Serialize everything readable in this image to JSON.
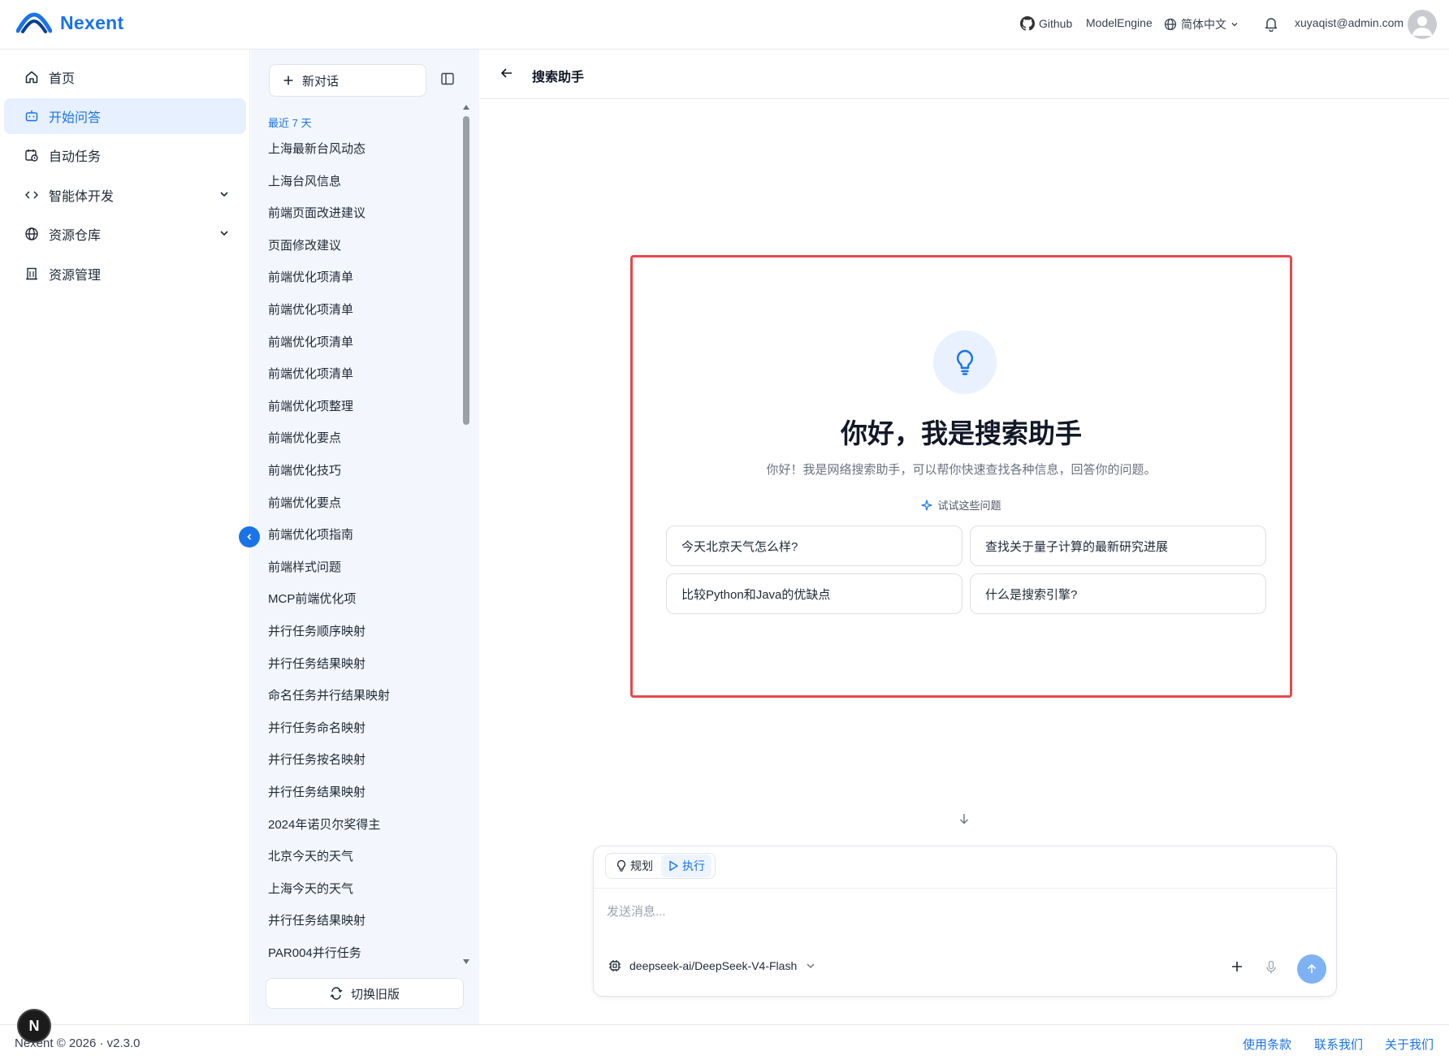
{
  "header": {
    "brand": "Nexent",
    "github_label": "Github",
    "modelengine_label": "ModelEngine",
    "language_label": "简体中文",
    "user_email": "xuyaqist@admin.com"
  },
  "nav": {
    "items": [
      {
        "label": "首页",
        "icon": "home-icon"
      },
      {
        "label": "开始问答",
        "icon": "robot-icon",
        "active": true
      },
      {
        "label": "自动任务",
        "icon": "calendar-clock-icon"
      },
      {
        "label": "智能体开发",
        "icon": "code-icon",
        "expandable": true
      },
      {
        "label": "资源仓库",
        "icon": "globe-icon",
        "expandable": true
      },
      {
        "label": "资源管理",
        "icon": "building-icon"
      }
    ]
  },
  "conversations": {
    "new_chat_label": "新对话",
    "recent_label": "最近 7 天",
    "items": [
      "上海最新台风动态",
      "上海台风信息",
      "前端页面改进建议",
      "页面修改建议",
      "前端优化项清单",
      "前端优化项清单",
      "前端优化项清单",
      "前端优化项清单",
      "前端优化项整理",
      "前端优化要点",
      "前端优化技巧",
      "前端优化要点",
      "前端优化项指南",
      "前端样式问题",
      "MCP前端优化项",
      "并行任务顺序映射",
      "并行任务结果映射",
      "命名任务并行结果映射",
      "并行任务命名映射",
      "并行任务按名映射",
      "并行任务结果映射",
      "2024年诺贝尔奖得主",
      "北京今天的天气",
      "上海今天的天气",
      "并行任务结果映射",
      "PAR004并行任务"
    ],
    "switch_old_label": "切换旧版"
  },
  "main": {
    "agent_title": "搜索助手",
    "welcome_title": "你好，我是搜索助手",
    "welcome_subtitle": "你好！我是网络搜索助手，可以帮你快速查找各种信息，回答你的问题。",
    "try_label": "试试这些问题",
    "suggestions": [
      "今天北京天气怎么样?",
      "查找关于量子计算的最新研究进展",
      "比较Python和Java的优缺点",
      "什么是搜索引擎?"
    ]
  },
  "composer": {
    "plan_label": "规划",
    "execute_label": "执行",
    "placeholder": "发送消息...",
    "model": "deepseek-ai/DeepSeek-V4-Flash"
  },
  "footer": {
    "copyright": "Nexent © 2026 · v2.3.0",
    "links": [
      "使用条款",
      "联系我们",
      "关于我们"
    ],
    "badge": "N"
  },
  "colors": {
    "accent": "#1a73e8",
    "highlight_border": "#e5484d",
    "panel_bg": "#f3f7fd",
    "send_button": "#7fb2f5"
  }
}
